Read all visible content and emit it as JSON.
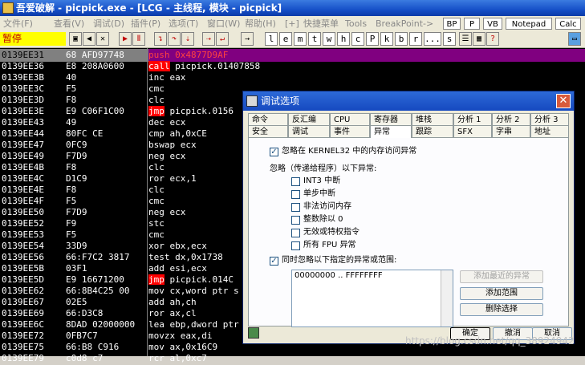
{
  "window": {
    "title": "吾爱破解 - picpick.exe - [LCG - 主线程, 模块 - picpick]"
  },
  "menu": {
    "items": [
      "文件(F)",
      "查看(V)",
      "调试(D)",
      "插件(P)",
      "选项(T)",
      "窗口(W)",
      "帮助(H)",
      "[+]",
      "快捷菜单",
      "Tools",
      "BreakPoint->"
    ],
    "buttons": [
      "BP",
      "P",
      "VB",
      "Notepad",
      "Calc"
    ]
  },
  "toolbar": {
    "status": "暂停",
    "letters": [
      "l",
      "e",
      "m",
      "t",
      "w",
      "h",
      "c",
      "P",
      "k",
      "b",
      "r",
      "...",
      "s"
    ]
  },
  "cpu": {
    "rows": [
      {
        "addr": "0139EE31",
        "hex": "68 AFD97748",
        "asm": "push 0x4877D9AF",
        "sel": true
      },
      {
        "addr": "0139EE36",
        "hex": "E8 208A0600",
        "op": "call",
        "rest": " picpick.01407858"
      },
      {
        "addr": "0139EE3B",
        "hex": "40",
        "asm": "inc eax"
      },
      {
        "addr": "0139EE3C",
        "hex": "F5",
        "asm": "cmc"
      },
      {
        "addr": "0139EE3D",
        "hex": "F8",
        "asm": "clc"
      },
      {
        "addr": "0139EE3E",
        "hex": "E9 C06F1C00",
        "op": "jmp",
        "rest": " picpick.0156"
      },
      {
        "addr": "0139EE43",
        "hex": "49",
        "asm": "dec ecx"
      },
      {
        "addr": "0139EE44",
        "hex": "80FC CE",
        "asm": "cmp ah,0xCE"
      },
      {
        "addr": "0139EE47",
        "hex": "0FC9",
        "asm": "bswap ecx"
      },
      {
        "addr": "0139EE49",
        "hex": "F7D9",
        "asm": "neg ecx"
      },
      {
        "addr": "0139EE4B",
        "hex": "F8",
        "asm": "clc"
      },
      {
        "addr": "0139EE4C",
        "hex": "D1C9",
        "asm": "ror ecx,1"
      },
      {
        "addr": "0139EE4E",
        "hex": "F8",
        "asm": "clc"
      },
      {
        "addr": "0139EE4F",
        "hex": "F5",
        "asm": "cmc"
      },
      {
        "addr": "0139EE50",
        "hex": "F7D9",
        "asm": "neg ecx"
      },
      {
        "addr": "0139EE52",
        "hex": "F9",
        "asm": "stc"
      },
      {
        "addr": "0139EE53",
        "hex": "F5",
        "asm": "cmc"
      },
      {
        "addr": "0139EE54",
        "hex": "33D9",
        "asm": "xor ebx,ecx"
      },
      {
        "addr": "0139EE56",
        "hex": "66:F7C2 3817",
        "asm": "test dx,0x1738"
      },
      {
        "addr": "0139EE5B",
        "hex": "03F1",
        "asm": "add esi,ecx"
      },
      {
        "addr": "0139EE5D",
        "hex": "E9 16671200",
        "op": "jmp",
        "rest": " picpick.014C"
      },
      {
        "addr": "0139EE62",
        "hex": "66:8B4C25 00",
        "asm": "mov cx,word ptr s"
      },
      {
        "addr": "0139EE67",
        "hex": "02E5",
        "asm": "add ah,ch"
      },
      {
        "addr": "0139EE69",
        "hex": "66:D3C8",
        "asm": "ror ax,cl"
      },
      {
        "addr": "0139EE6C",
        "hex": "8DAD 02000000",
        "asm": "lea ebp,dword ptr"
      },
      {
        "addr": "0139EE72",
        "hex": "0FB7C7",
        "asm": "movzx eax,di"
      },
      {
        "addr": "0139EE75",
        "hex": "66:B8 C916",
        "asm": "mov ax,0x16C9"
      },
      {
        "addr": "0139EE79",
        "hex": "c0d8 c7",
        "asm": "rcr al,0xc7"
      }
    ]
  },
  "dialog": {
    "title": "调试选项",
    "tabs_row1": [
      "命令",
      "反汇编",
      "CPU",
      "寄存器",
      "堆栈",
      "分析 1",
      "分析 2",
      "分析 3"
    ],
    "tabs_row2": [
      "安全",
      "调试",
      "事件",
      "异常",
      "跟踪",
      "SFX",
      "字串",
      "地址"
    ],
    "ignore_kernel": "忽略在 KERNEL32 中的内存访问异常",
    "ignore_heading": "忽略（传递给程序）以下异常:",
    "exceptions": [
      "INT3 中断",
      "单步中断",
      "非法访问内存",
      "整数除以 0",
      "无效或特权指令",
      "所有 FPU 异常"
    ],
    "range_label": "同时忽略以下指定的异常或范围:",
    "range_value": "00000000 .. FFFFFFFF",
    "btn_add_recent": "添加最近的异常",
    "btn_add_range": "添加范围",
    "btn_delete": "删除选择",
    "ok": "确定",
    "cancel": "撤消",
    "cancel2": "取消"
  },
  "watermark": "https://blog.csdn.net/qq_38924942"
}
